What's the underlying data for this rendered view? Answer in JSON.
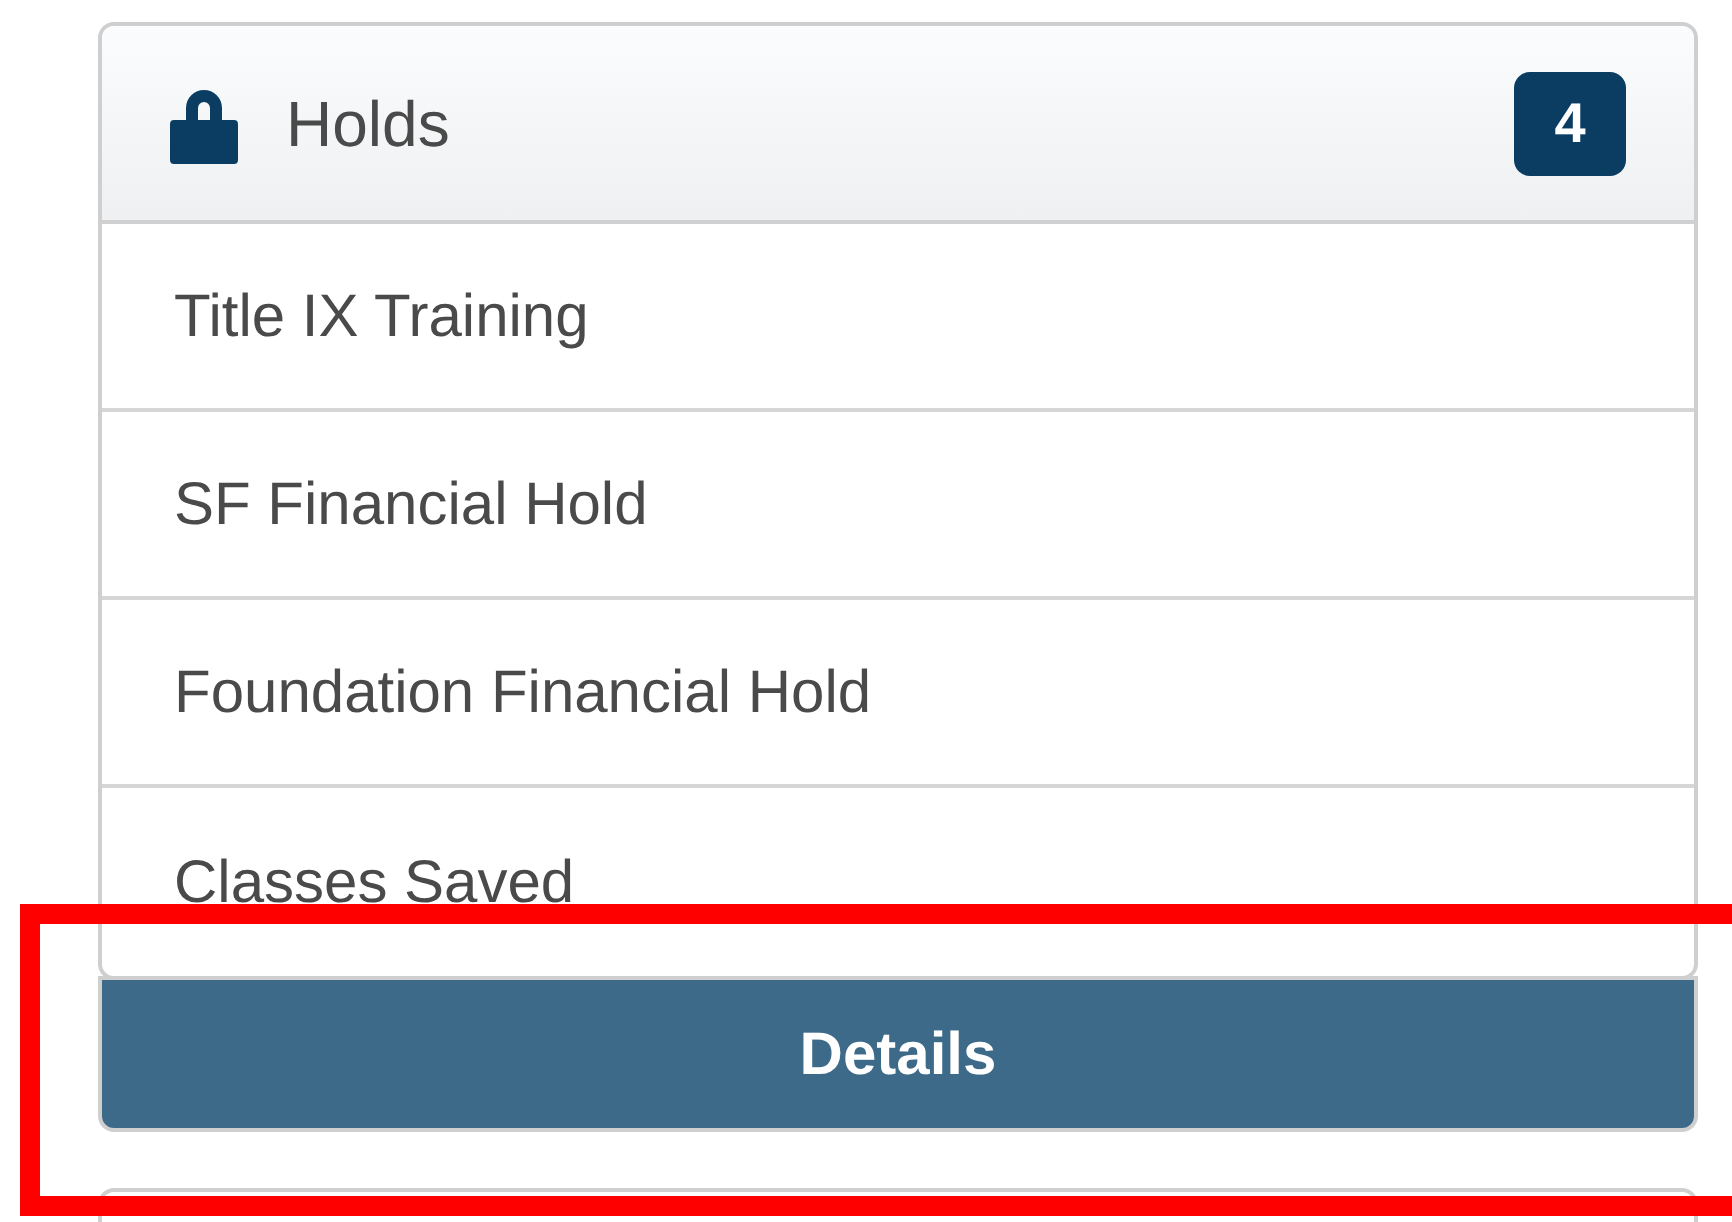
{
  "card": {
    "title": "Holds",
    "count": "4",
    "items": [
      {
        "label": "Title IX Training"
      },
      {
        "label": "SF Financial Hold"
      },
      {
        "label": "Foundation Financial Hold"
      },
      {
        "label": "Classes Saved"
      }
    ],
    "button": "Details"
  }
}
